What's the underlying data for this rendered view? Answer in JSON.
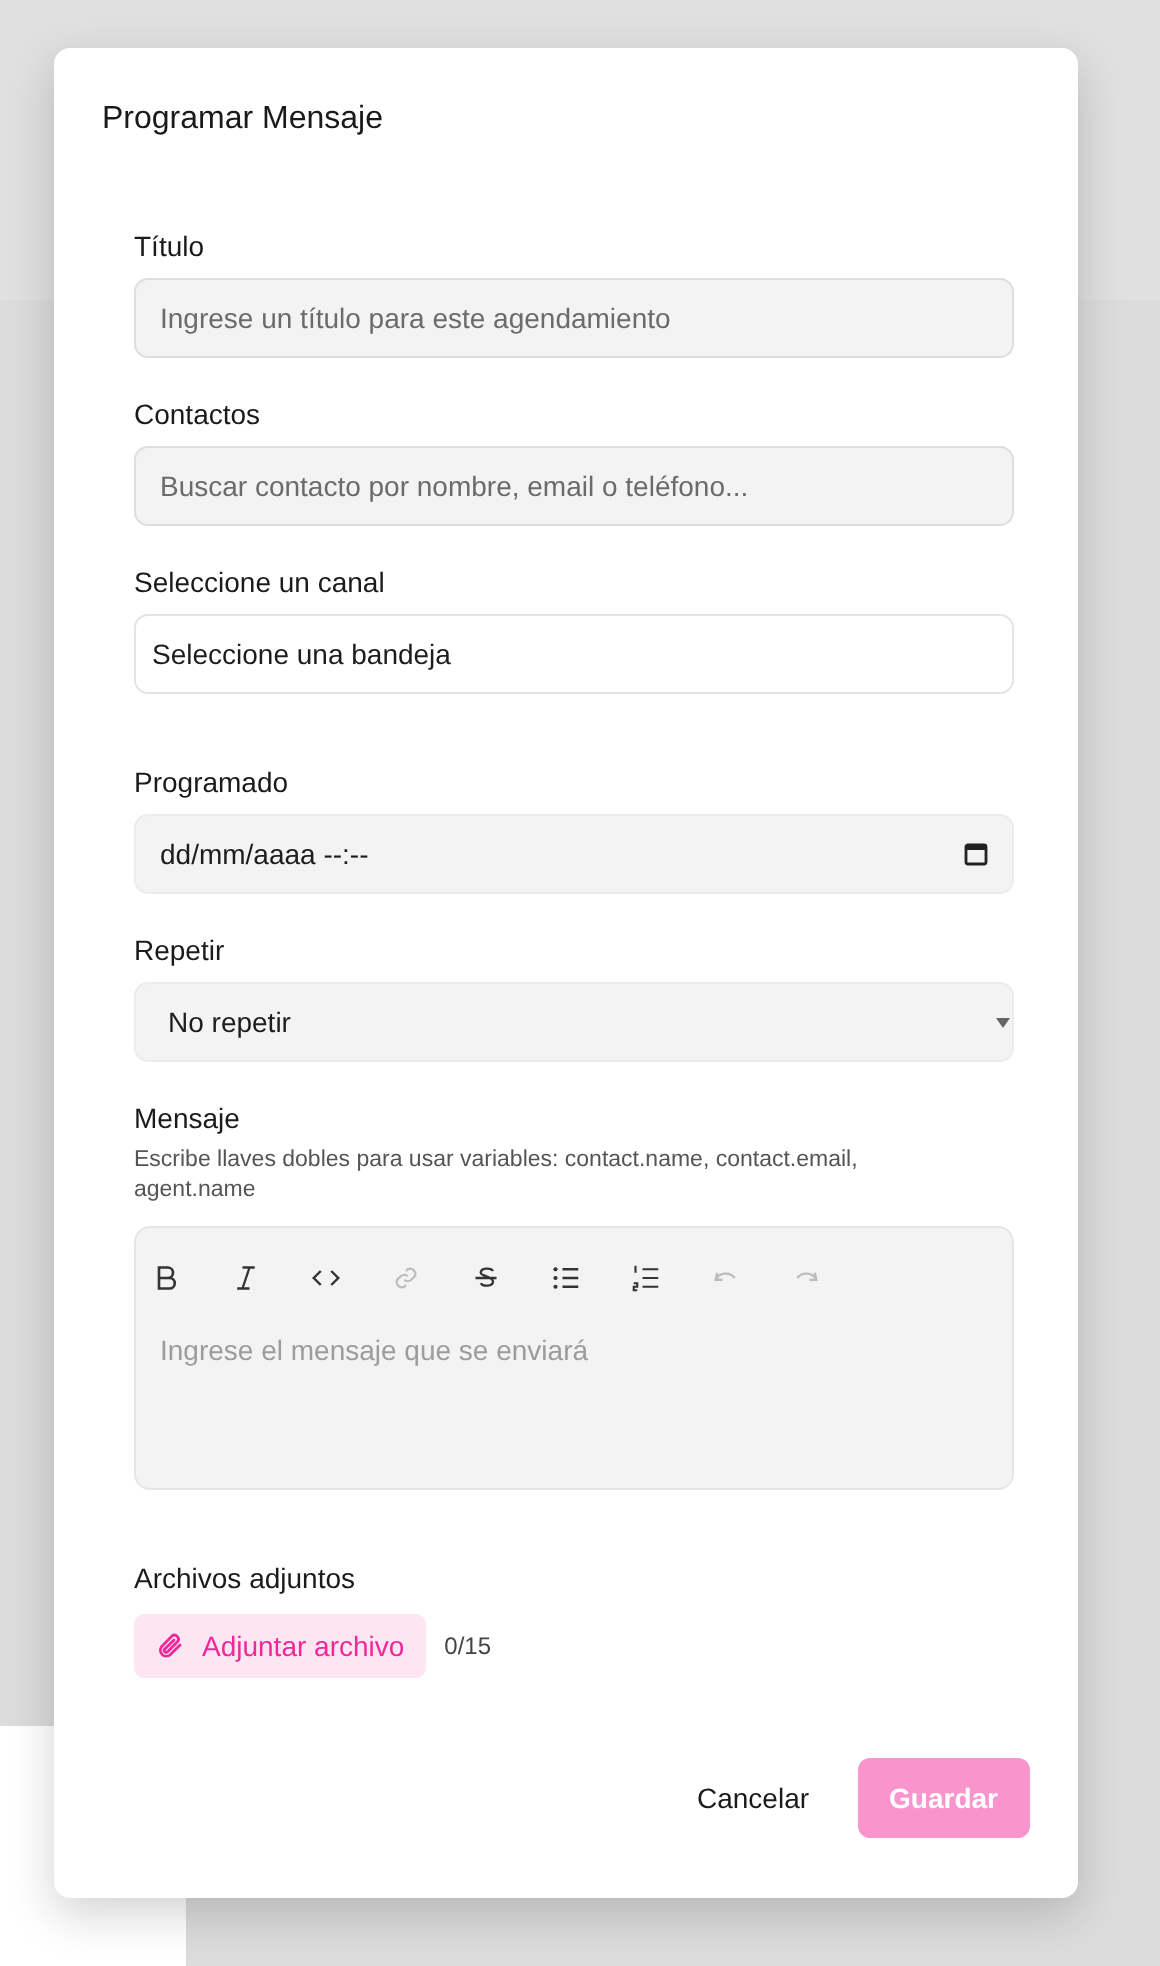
{
  "dialog": {
    "title": "Programar Mensaje"
  },
  "fields": [
    {
      "kind": "text",
      "label": "Título",
      "placeholder": "Ingrese un título para este agendamiento"
    },
    {
      "kind": "text",
      "label": "Contactos",
      "placeholder": "Buscar contacto por nombre, email o teléfono..."
    },
    {
      "kind": "select-plain",
      "label": "Seleccione un canal",
      "value": "Seleccione una bandeja"
    },
    {
      "kind": "datetime",
      "label": "Programado",
      "placeholder": "dd/mm/aaaa --:--"
    },
    {
      "kind": "select",
      "label": "Repetir",
      "value": "No repetir"
    }
  ],
  "message": {
    "label": "Mensaje",
    "hint": "Escribe llaves dobles para usar variables: contact.name, contact.email, agent.name",
    "placeholder": "Ingrese el mensaje que se enviará",
    "toolbar": [
      {
        "kind": "bold",
        "disabled": false
      },
      {
        "kind": "italic",
        "disabled": false
      },
      {
        "kind": "code",
        "disabled": false
      },
      {
        "kind": "link",
        "disabled": true
      },
      {
        "kind": "strike",
        "disabled": false
      },
      {
        "kind": "bullet-list",
        "disabled": false
      },
      {
        "kind": "ordered-list",
        "disabled": false
      },
      {
        "kind": "undo",
        "disabled": true
      },
      {
        "kind": "redo",
        "disabled": true
      }
    ]
  },
  "attachments": {
    "label": "Archivos adjuntos",
    "button": "Adjuntar archivo",
    "count": "0/15"
  },
  "buttons": [
    {
      "kind": "secondary",
      "label": "Cancelar",
      "disabled": false
    },
    {
      "kind": "primary",
      "label": "Guardar",
      "disabled": true
    }
  ]
}
